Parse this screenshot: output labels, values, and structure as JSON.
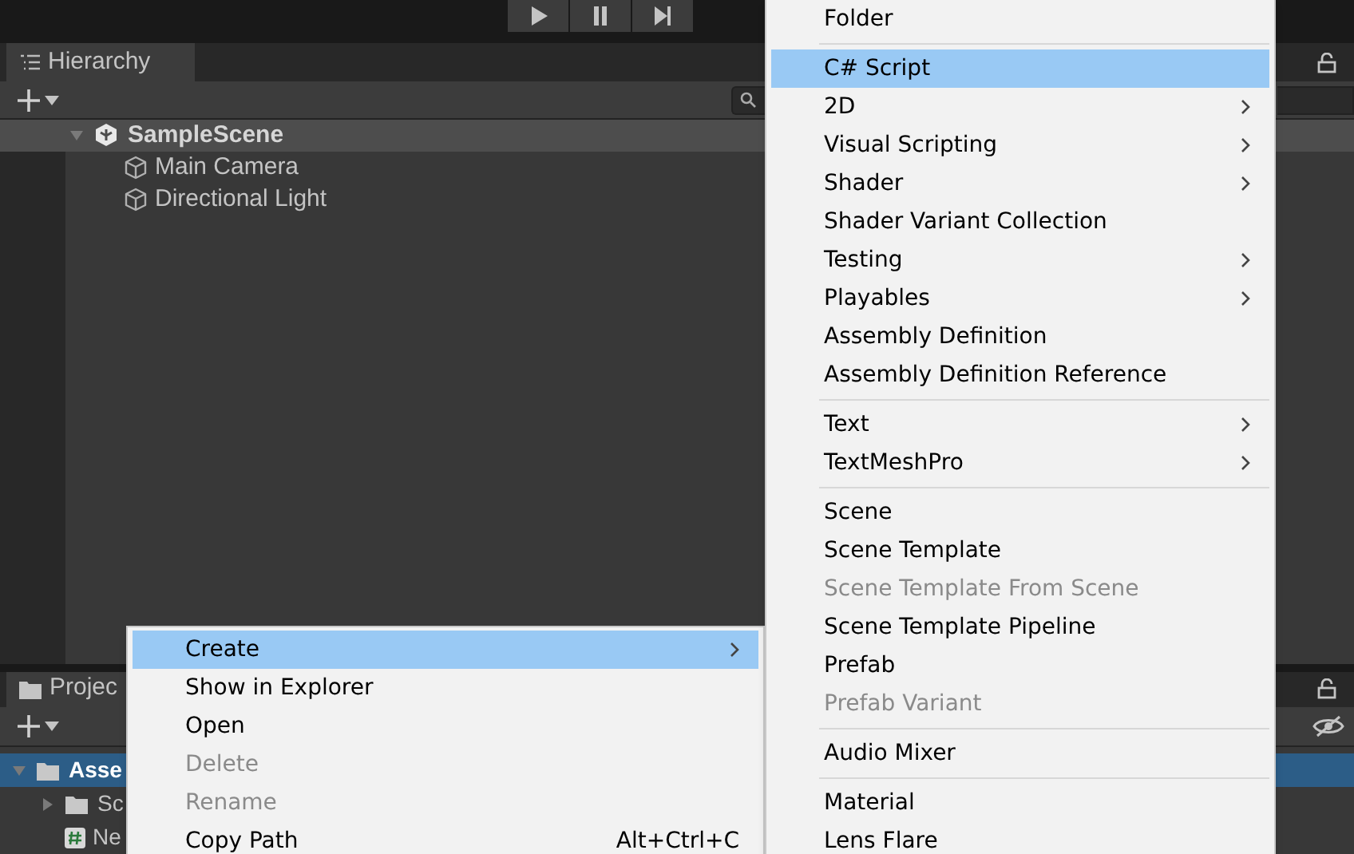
{
  "hierarchy": {
    "tab": "Hierarchy",
    "scene": {
      "name": "SampleScene",
      "expanded": true
    },
    "objects": [
      "Main Camera",
      "Directional Light"
    ]
  },
  "project": {
    "tab": "Projec",
    "items": [
      {
        "kind": "folder",
        "label": "Asse",
        "selected": true,
        "expanded": true,
        "bold": true,
        "children": [
          {
            "kind": "folder",
            "label": "Sc",
            "selected": false,
            "expanded": false,
            "bold": false
          },
          {
            "kind": "script",
            "label": "Ne",
            "selected": false,
            "bold": false
          }
        ]
      }
    ]
  },
  "context_menu": {
    "items": [
      {
        "label": "Create",
        "selected": true,
        "disabled": false,
        "has_submenu": true
      },
      {
        "label": "Show in Explorer",
        "selected": false,
        "disabled": false,
        "has_submenu": false
      },
      {
        "label": "Open",
        "selected": false,
        "disabled": false,
        "has_submenu": false
      },
      {
        "label": "Delete",
        "selected": false,
        "disabled": true,
        "has_submenu": false
      },
      {
        "label": "Rename",
        "selected": false,
        "disabled": true,
        "has_submenu": false
      },
      {
        "label": "Copy Path",
        "selected": false,
        "disabled": false,
        "has_submenu": false,
        "shortcut": "Alt+Ctrl+C"
      }
    ]
  },
  "create_submenu": {
    "items": [
      {
        "kind": "item",
        "label": "Folder",
        "selected": false,
        "disabled": false,
        "has_submenu": false
      },
      {
        "kind": "separator"
      },
      {
        "kind": "item",
        "label": "C# Script",
        "selected": true,
        "disabled": false,
        "has_submenu": false
      },
      {
        "kind": "item",
        "label": "2D",
        "selected": false,
        "disabled": false,
        "has_submenu": true
      },
      {
        "kind": "item",
        "label": "Visual Scripting",
        "selected": false,
        "disabled": false,
        "has_submenu": true
      },
      {
        "kind": "item",
        "label": "Shader",
        "selected": false,
        "disabled": false,
        "has_submenu": true
      },
      {
        "kind": "item",
        "label": "Shader Variant Collection",
        "selected": false,
        "disabled": false,
        "has_submenu": false
      },
      {
        "kind": "item",
        "label": "Testing",
        "selected": false,
        "disabled": false,
        "has_submenu": true
      },
      {
        "kind": "item",
        "label": "Playables",
        "selected": false,
        "disabled": false,
        "has_submenu": true
      },
      {
        "kind": "item",
        "label": "Assembly Definition",
        "selected": false,
        "disabled": false,
        "has_submenu": false
      },
      {
        "kind": "item",
        "label": "Assembly Definition Reference",
        "selected": false,
        "disabled": false,
        "has_submenu": false
      },
      {
        "kind": "separator"
      },
      {
        "kind": "item",
        "label": "Text",
        "selected": false,
        "disabled": false,
        "has_submenu": true
      },
      {
        "kind": "item",
        "label": "TextMeshPro",
        "selected": false,
        "disabled": false,
        "has_submenu": true
      },
      {
        "kind": "separator"
      },
      {
        "kind": "item",
        "label": "Scene",
        "selected": false,
        "disabled": false,
        "has_submenu": false
      },
      {
        "kind": "item",
        "label": "Scene Template",
        "selected": false,
        "disabled": false,
        "has_submenu": false
      },
      {
        "kind": "item",
        "label": "Scene Template From Scene",
        "selected": false,
        "disabled": true,
        "has_submenu": false
      },
      {
        "kind": "item",
        "label": "Scene Template Pipeline",
        "selected": false,
        "disabled": false,
        "has_submenu": false
      },
      {
        "kind": "item",
        "label": "Prefab",
        "selected": false,
        "disabled": false,
        "has_submenu": false
      },
      {
        "kind": "item",
        "label": "Prefab Variant",
        "selected": false,
        "disabled": true,
        "has_submenu": false
      },
      {
        "kind": "separator"
      },
      {
        "kind": "item",
        "label": "Audio Mixer",
        "selected": false,
        "disabled": false,
        "has_submenu": false
      },
      {
        "kind": "separator"
      },
      {
        "kind": "item",
        "label": "Material",
        "selected": false,
        "disabled": false,
        "has_submenu": false
      },
      {
        "kind": "item",
        "label": "Lens Flare",
        "selected": false,
        "disabled": false,
        "has_submenu": false
      }
    ]
  }
}
